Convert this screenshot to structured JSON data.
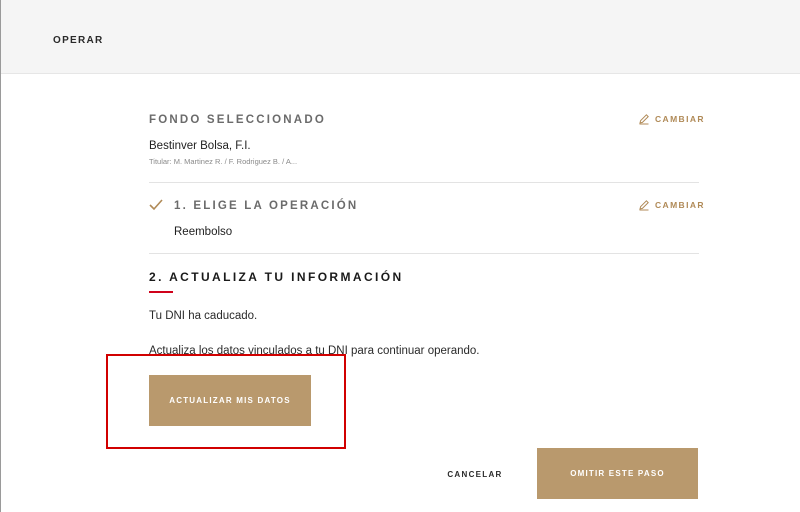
{
  "header": {
    "title": "OPERAR"
  },
  "fund": {
    "section_label": "FONDO SELECCIONADO",
    "change_label": "CAMBIAR",
    "name": "Bestinver Bolsa, F.I.",
    "holders": "Titular: M. Martinez R. / F. Rodriguez B. / A..."
  },
  "step1": {
    "label": "1. ELIGE LA OPERACIÓN",
    "change_label": "CAMBIAR",
    "value": "Reembolso"
  },
  "step2": {
    "title": "2. ACTUALIZA TU INFORMACIÓN",
    "message1": "Tu DNI ha caducado.",
    "message2": "Actualiza los datos vinculados a tu DNI para continuar operando.",
    "update_button": "ACTUALIZAR MIS DATOS"
  },
  "footer": {
    "cancel_button": "CANCELAR",
    "skip_button": "OMITIR ESTE PASO"
  },
  "colors": {
    "accent": "#b9996d",
    "link": "#b08a57",
    "alert_red": "#d0021b",
    "topbar_bg": "#f5f5f5"
  },
  "icons": {
    "edit": "pencil-icon",
    "done": "checkmark-icon"
  }
}
